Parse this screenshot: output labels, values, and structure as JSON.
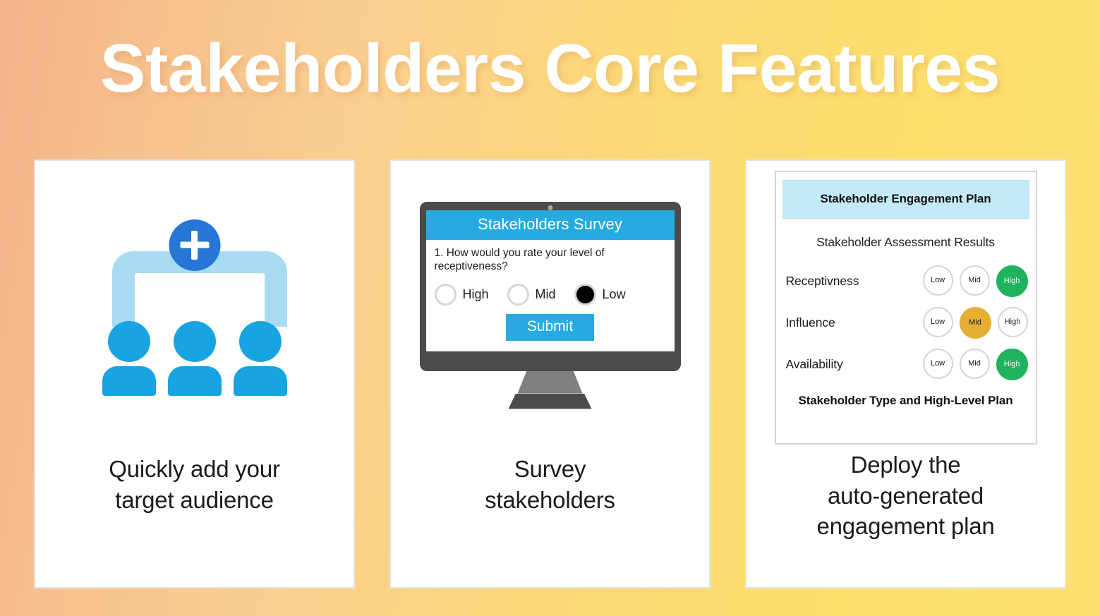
{
  "page": {
    "title": "Stakeholders Core Features",
    "background_start": "#f4b389",
    "background_end": "#fde071"
  },
  "cards": [
    {
      "caption_line1": "Quickly add your",
      "caption_line2": "target audience",
      "icon": "add-audience-icon",
      "accent": "#18a3e2",
      "accent_badge": "#2576d6",
      "accent_light": "#a9dcf2"
    },
    {
      "caption_line1": "Survey",
      "caption_line2": "stakeholders",
      "icon": "monitor-icon",
      "accent": "#27aae1"
    },
    {
      "caption_line1": "Deploy the",
      "caption_line2": "auto-generated",
      "caption_line3": "engagement plan",
      "icon": "document-icon"
    }
  ],
  "survey": {
    "header": "Stakeholders Survey",
    "question": "1. How would you rate your level of receptiveness?",
    "options": [
      {
        "label": "High",
        "selected": false
      },
      {
        "label": "Mid",
        "selected": false
      },
      {
        "label": "Low",
        "selected": true
      }
    ],
    "submit_label": "Submit",
    "header_color": "#27aae1",
    "submit_color": "#27aae1"
  },
  "plan": {
    "header": "Stakeholder Engagement Plan",
    "subtitle": "Stakeholder Assessment Results",
    "footer": "Stakeholder Type and High-Level Plan",
    "header_bg": "#c5eaf7",
    "high_color": "#20b35d",
    "mid_color": "#e8ae34",
    "rows": [
      {
        "label": "Receptivness",
        "badges": [
          {
            "label": "Low",
            "state": "inactive"
          },
          {
            "label": "Mid",
            "state": "inactive"
          },
          {
            "label": "High",
            "state": "active-high"
          }
        ]
      },
      {
        "label": "Influence",
        "badges": [
          {
            "label": "Low",
            "state": "inactive"
          },
          {
            "label": "Mid",
            "state": "active-mid"
          },
          {
            "label": "High",
            "state": "inactive"
          }
        ]
      },
      {
        "label": "Availability",
        "badges": [
          {
            "label": "Low",
            "state": "inactive"
          },
          {
            "label": "Mid",
            "state": "inactive"
          },
          {
            "label": "High",
            "state": "active-high"
          }
        ]
      }
    ]
  }
}
